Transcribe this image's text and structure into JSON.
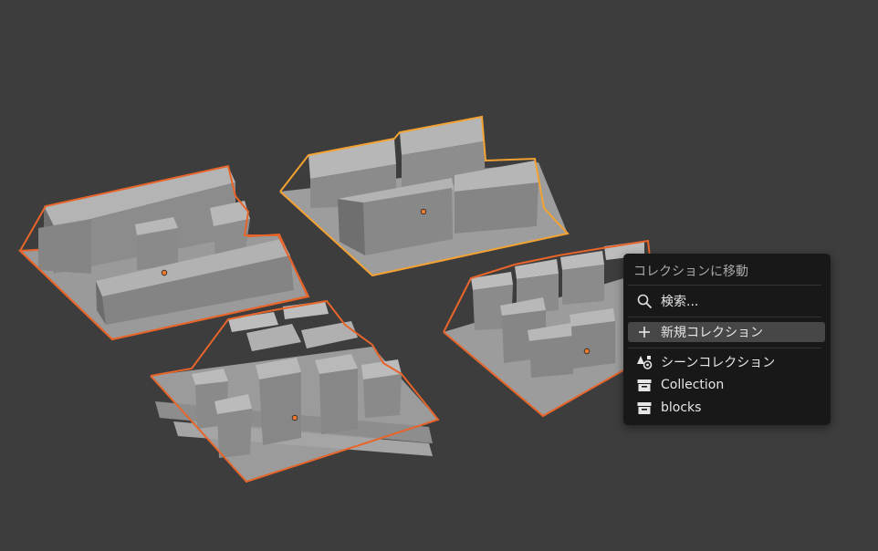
{
  "menu": {
    "title": "コレクションに移動",
    "items": [
      {
        "label": "検索...",
        "icon": "search-icon"
      },
      {
        "label": "新規コレクション",
        "icon": "plus-icon"
      },
      {
        "label": "シーンコレクション",
        "icon": "scene-collection-icon"
      },
      {
        "label": "Collection",
        "icon": "collection-box-icon"
      },
      {
        "label": "blocks",
        "icon": "collection-box-icon"
      }
    ]
  },
  "colors": {
    "viewport_bg": "#3d3d3d",
    "active_outline": "#f4a232",
    "selected_outline": "#e7652a",
    "menu_bg": "#181818",
    "menu_highlight": "#474747"
  }
}
